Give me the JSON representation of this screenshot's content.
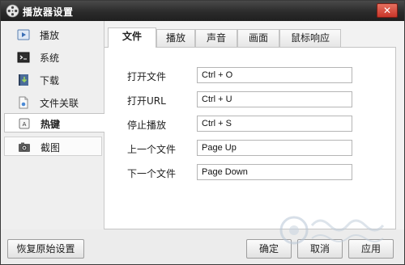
{
  "window": {
    "title": "播放器设置",
    "close_label": "✕"
  },
  "sidebar": {
    "items": [
      {
        "label": "播放",
        "icon": "play-icon"
      },
      {
        "label": "系统",
        "icon": "terminal-icon"
      },
      {
        "label": "下载",
        "icon": "download-icon"
      },
      {
        "label": "文件关联",
        "icon": "file-icon"
      },
      {
        "label": "热键",
        "icon": "keyboard-icon",
        "active": true
      },
      {
        "label": "截图",
        "icon": "camera-icon"
      }
    ]
  },
  "tabs": [
    {
      "label": "文件",
      "active": true
    },
    {
      "label": "播放"
    },
    {
      "label": "声音"
    },
    {
      "label": "画面"
    },
    {
      "label": "鼠标响应"
    }
  ],
  "hotkeys": [
    {
      "label": "打开文件",
      "value": "Ctrl + O"
    },
    {
      "label": "打开URL",
      "value": "Ctrl + U"
    },
    {
      "label": "停止播放",
      "value": "Ctrl + S"
    },
    {
      "label": "上一个文件",
      "value": "Page Up"
    },
    {
      "label": "下一个文件",
      "value": "Page Down"
    }
  ],
  "footer": {
    "restore_label": "恢复原始设置",
    "ok_label": "确定",
    "cancel_label": "取消",
    "apply_label": "应用"
  },
  "colors": {
    "titlebar": "#2b2b2b",
    "close_button": "#c7362a",
    "panel": "#ffffff",
    "sidebar": "#efefef"
  }
}
